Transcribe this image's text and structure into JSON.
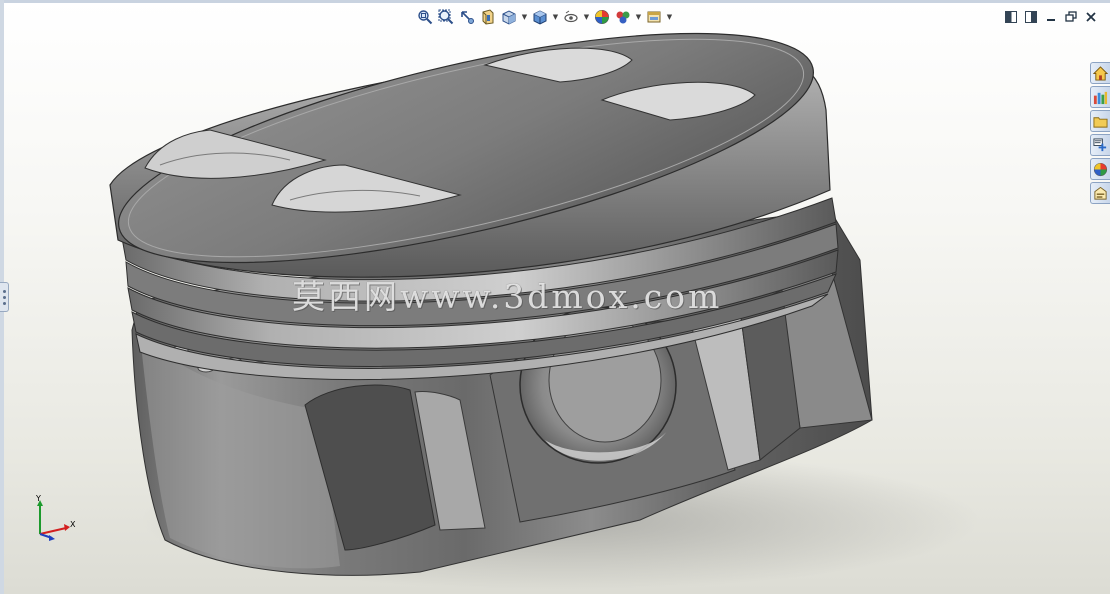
{
  "heads_up_toolbar": {
    "tools": [
      {
        "icon": "zoom-to-fit-icon",
        "dropdown": false
      },
      {
        "icon": "zoom-to-area-icon",
        "dropdown": false
      },
      {
        "icon": "previous-view-icon",
        "dropdown": false
      },
      {
        "icon": "section-view-icon",
        "dropdown": false
      },
      {
        "icon": "view-orientation-icon",
        "dropdown": true
      },
      {
        "icon": "display-style-icon",
        "dropdown": true
      },
      {
        "icon": "hide-show-items-icon",
        "dropdown": true
      },
      {
        "icon": "edit-appearance-icon",
        "dropdown": false
      },
      {
        "icon": "apply-scene-icon",
        "dropdown": true
      },
      {
        "icon": "view-settings-icon",
        "dropdown": true
      }
    ]
  },
  "window_controls": [
    "split-vertical-icon",
    "split-horizontal-icon",
    "minimize-icon",
    "restore-icon",
    "close-icon"
  ],
  "task_pane": {
    "tabs": [
      "home-icon",
      "design-library-icon",
      "file-explorer-icon",
      "view-palette-icon",
      "appearances-icon",
      "custom-properties-icon"
    ]
  },
  "watermark": "莫西网www.3dmox.com",
  "triad": {
    "x_label": "X",
    "y_label": "Y"
  },
  "colors": {
    "triad_x": "#d32020",
    "triad_y": "#1c9a2c",
    "triad_z": "#1f3fbf",
    "model_shade": "#8a8a8a"
  }
}
